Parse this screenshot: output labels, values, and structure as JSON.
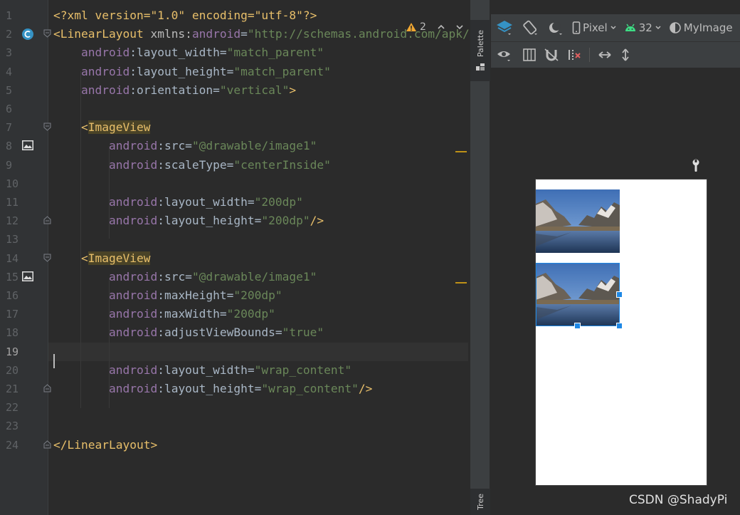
{
  "editor": {
    "line_numbers": [
      "1",
      "2",
      "3",
      "4",
      "5",
      "6",
      "7",
      "8",
      "9",
      "10",
      "11",
      "12",
      "13",
      "14",
      "15",
      "16",
      "17",
      "18",
      "19",
      "20",
      "21",
      "22",
      "23",
      "24"
    ],
    "inspection_count": "2",
    "lines": [
      [
        [
          "t",
          "<?xml version=\"1.0\" encoding=\"utf-8\"?>"
        ]
      ],
      [
        [
          "t",
          "<LinearLayout "
        ],
        [
          "ns",
          "xmlns:"
        ],
        [
          "an",
          "android"
        ],
        [
          "",
          "="
        ],
        [
          "av",
          "\"http://schemas.android.com/apk/res/android\""
        ]
      ],
      [
        [
          "",
          "    "
        ],
        [
          "an",
          "android"
        ],
        [
          "",
          ":layout_width="
        ],
        [
          "av",
          "\"match_parent\""
        ]
      ],
      [
        [
          "",
          "    "
        ],
        [
          "an",
          "android"
        ],
        [
          "",
          ":layout_height="
        ],
        [
          "av",
          "\"match_parent\""
        ]
      ],
      [
        [
          "",
          "    "
        ],
        [
          "an",
          "android"
        ],
        [
          "",
          ":orientation="
        ],
        [
          "av",
          "\"vertical\""
        ],
        [
          "t",
          ">"
        ]
      ],
      [],
      [
        [
          "",
          "    "
        ],
        [
          "t",
          "<"
        ],
        [
          "thl",
          "ImageView"
        ]
      ],
      [
        [
          "",
          "        "
        ],
        [
          "an",
          "android"
        ],
        [
          "",
          ":src="
        ],
        [
          "av",
          "\"@drawable/image1\""
        ]
      ],
      [
        [
          "",
          "        "
        ],
        [
          "an",
          "android"
        ],
        [
          "",
          ":scaleType="
        ],
        [
          "av",
          "\"centerInside\""
        ]
      ],
      [],
      [
        [
          "",
          "        "
        ],
        [
          "an",
          "android"
        ],
        [
          "",
          ":layout_width="
        ],
        [
          "av",
          "\"200dp\""
        ]
      ],
      [
        [
          "",
          "        "
        ],
        [
          "an",
          "android"
        ],
        [
          "",
          ":layout_height="
        ],
        [
          "av",
          "\"200dp\""
        ],
        [
          "t",
          "/>"
        ]
      ],
      [],
      [
        [
          "",
          "    "
        ],
        [
          "t",
          "<"
        ],
        [
          "thl",
          "ImageView"
        ]
      ],
      [
        [
          "",
          "        "
        ],
        [
          "an",
          "android"
        ],
        [
          "",
          ":src="
        ],
        [
          "av",
          "\"@drawable/image1\""
        ]
      ],
      [
        [
          "",
          "        "
        ],
        [
          "an",
          "android"
        ],
        [
          "",
          ":maxHeight="
        ],
        [
          "av",
          "\"200dp\""
        ]
      ],
      [
        [
          "",
          "        "
        ],
        [
          "an",
          "android"
        ],
        [
          "",
          ":maxWidth="
        ],
        [
          "av",
          "\"200dp\""
        ]
      ],
      [
        [
          "",
          "        "
        ],
        [
          "an",
          "android"
        ],
        [
          "",
          ":adjustViewBounds="
        ],
        [
          "av",
          "\"true\""
        ]
      ],
      [],
      [
        [
          "",
          "        "
        ],
        [
          "an",
          "android"
        ],
        [
          "",
          ":layout_width="
        ],
        [
          "av",
          "\"wrap_content\""
        ]
      ],
      [
        [
          "",
          "        "
        ],
        [
          "an",
          "android"
        ],
        [
          "",
          ":layout_height="
        ],
        [
          "av",
          "\"wrap_content\""
        ],
        [
          "t",
          "/>"
        ]
      ],
      [],
      [],
      [
        [
          "t",
          "</LinearLayout>"
        ]
      ]
    ]
  },
  "side_tabs": {
    "palette": "Palette",
    "tree": "Tree"
  },
  "design_toolbar": {
    "device": "Pixel",
    "api_level": "32",
    "theme": "MyImage"
  },
  "watermark": "CSDN @ShadyPi",
  "colors": {
    "accent": "#1e88e5",
    "warning": "#be9117"
  }
}
